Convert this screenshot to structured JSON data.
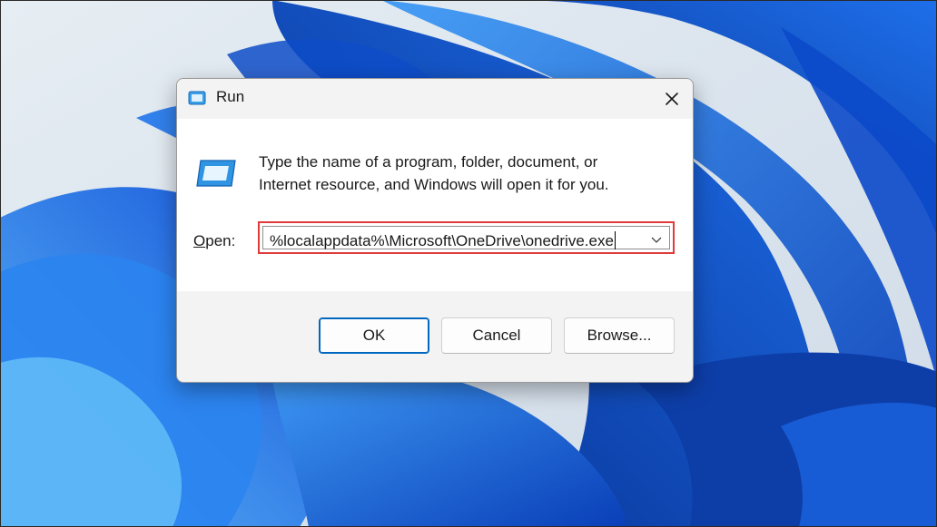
{
  "colors": {
    "wallpaper_bg": "#dfe8f0",
    "bloom_dark": "#0a3fb8",
    "bloom_mid": "#1565e8",
    "bloom_light": "#4aa3f5",
    "highlight_border": "#e03a3a",
    "accent": "#0067c0"
  },
  "dialog": {
    "title": "Run",
    "title_icon": "run-app-icon",
    "close_icon": "close-icon",
    "app_icon": "run-app-icon",
    "message_line1": "Type the name of a program, folder, document, or",
    "message_line2": "Internet resource, and Windows will open it for you.",
    "open_label": "Open:",
    "open_value": "%localappdata%\\Microsoft\\OneDrive\\onedrive.exe",
    "dropdown_icon": "chevron-down-icon",
    "buttons": {
      "ok": "OK",
      "cancel": "Cancel",
      "browse": "Browse..."
    }
  }
}
